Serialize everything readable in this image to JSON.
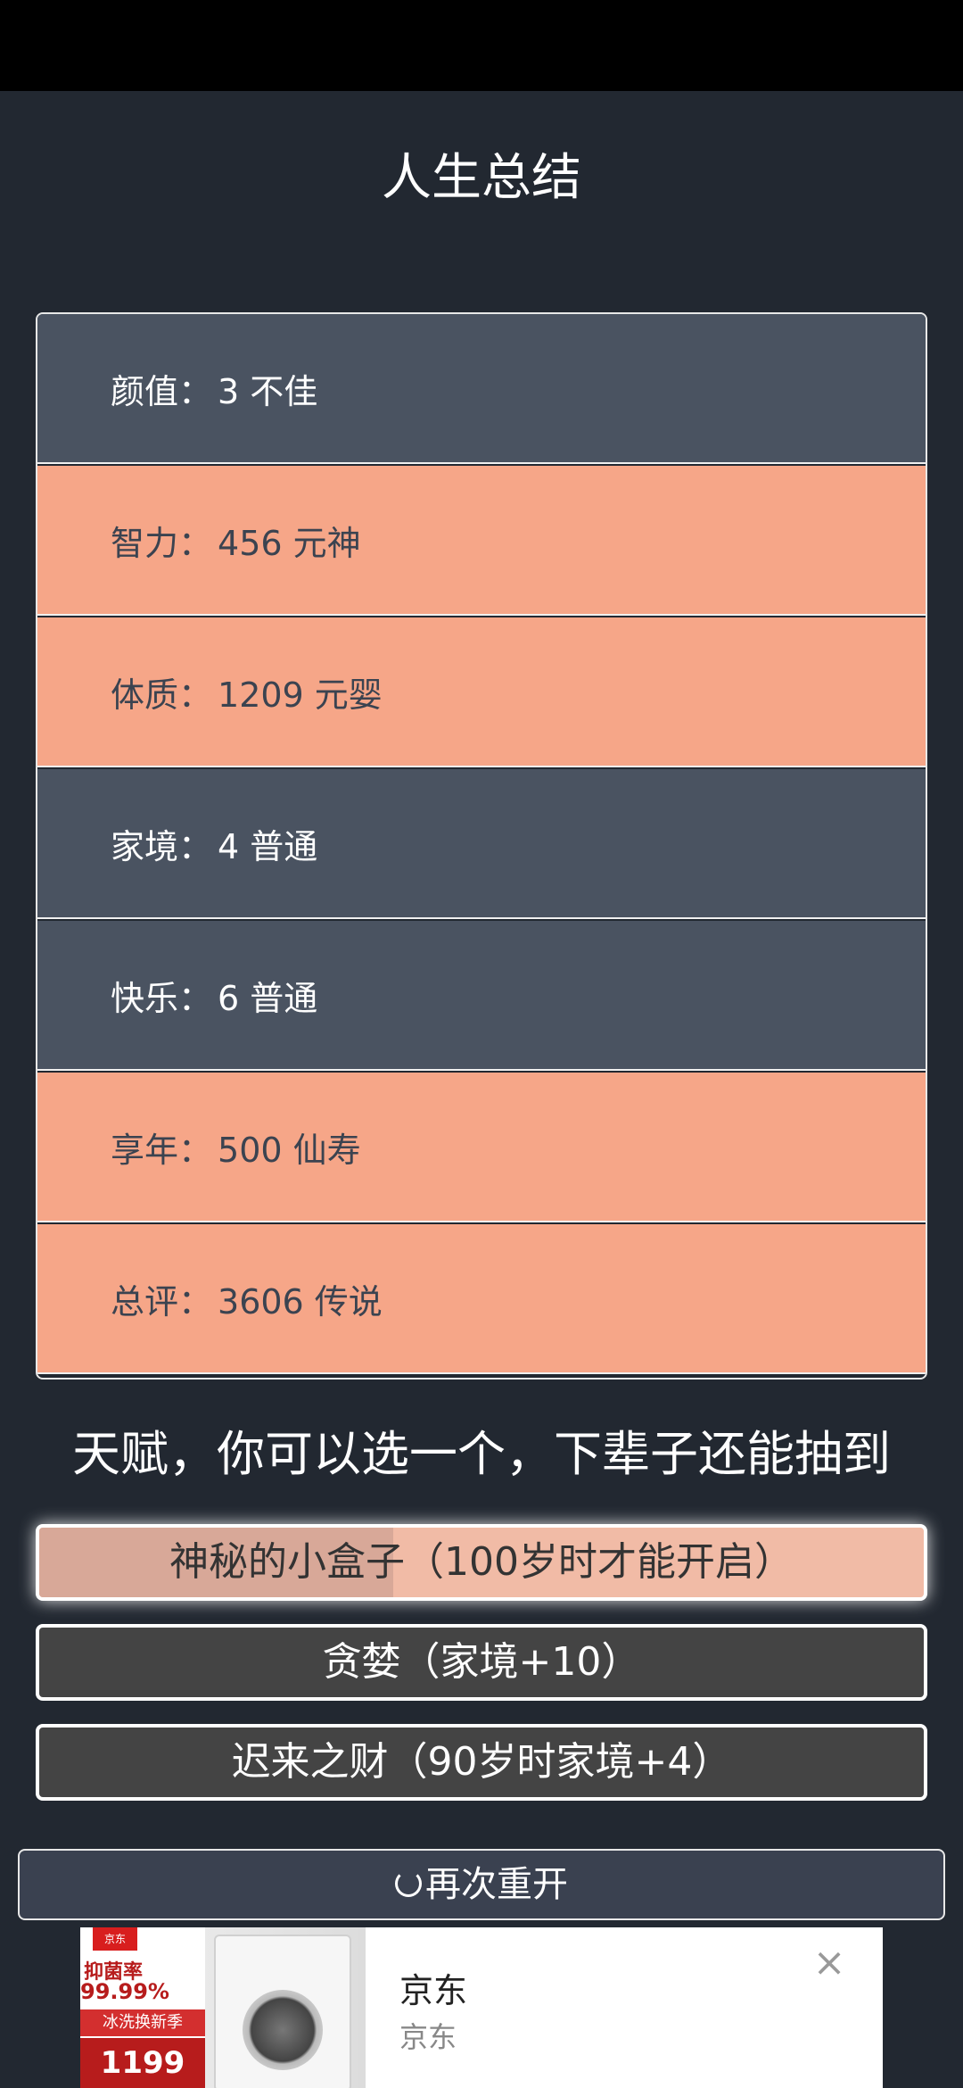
{
  "header": {
    "title": "人生总结"
  },
  "stats": [
    {
      "label": "颜值：",
      "value": "3 不佳",
      "highlight": false
    },
    {
      "label": "智力：",
      "value": "456 元神",
      "highlight": true
    },
    {
      "label": "体质：",
      "value": "1209 元婴",
      "highlight": true
    },
    {
      "label": "家境：",
      "value": "4 普通",
      "highlight": false
    },
    {
      "label": "快乐：",
      "value": "6 普通",
      "highlight": false
    },
    {
      "label": "享年：",
      "value": "500 仙寿",
      "highlight": true
    },
    {
      "label": "总评：",
      "value": "3606 传说",
      "highlight": true
    }
  ],
  "talents": {
    "heading": "天赋，你可以选一个，下辈子还能抽到",
    "options": [
      {
        "label": "神秘的小盒子（100岁时才能开启）",
        "selected": true
      },
      {
        "label": "贪婪（家境+10）",
        "selected": false
      },
      {
        "label": "迟来之财（90岁时家境+4）",
        "selected": false
      }
    ]
  },
  "restart": {
    "icon": "loading-spinner-icon",
    "label": "再次重开"
  },
  "ad": {
    "title": "京东",
    "subtitle": "京东",
    "close_icon": "close-icon",
    "image": {
      "brand": "京东",
      "line1": "抑菌率",
      "line2": "99.99%",
      "line3": "冰洗换新季",
      "price": "1199"
    }
  },
  "colors": {
    "background": "#222831",
    "row_dim": "#4a5361",
    "row_highlight": "#f6a688",
    "option_selected": "#f1bba6",
    "option_plain": "#444444"
  }
}
